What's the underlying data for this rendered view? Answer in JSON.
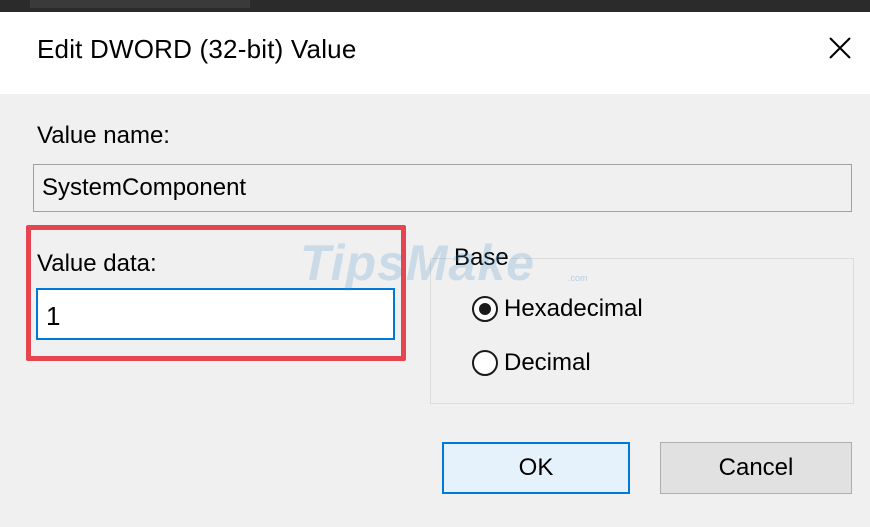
{
  "dialog": {
    "title": "Edit DWORD (32-bit) Value",
    "close_icon": "close-icon"
  },
  "fields": {
    "value_name_label": "Value name:",
    "value_name": "SystemComponent",
    "value_data_label": "Value data:",
    "value_data": "1"
  },
  "base": {
    "legend": "Base",
    "options": [
      {
        "label": "Hexadecimal",
        "selected": true
      },
      {
        "label": "Decimal",
        "selected": false
      }
    ]
  },
  "buttons": {
    "ok": "OK",
    "cancel": "Cancel"
  },
  "watermark": {
    "text": "TipsMake",
    "sub": ".com"
  },
  "colors": {
    "highlight": "#e4454f",
    "focus_accent": "#0078d7",
    "dialog_bg": "#f0f0f0"
  }
}
